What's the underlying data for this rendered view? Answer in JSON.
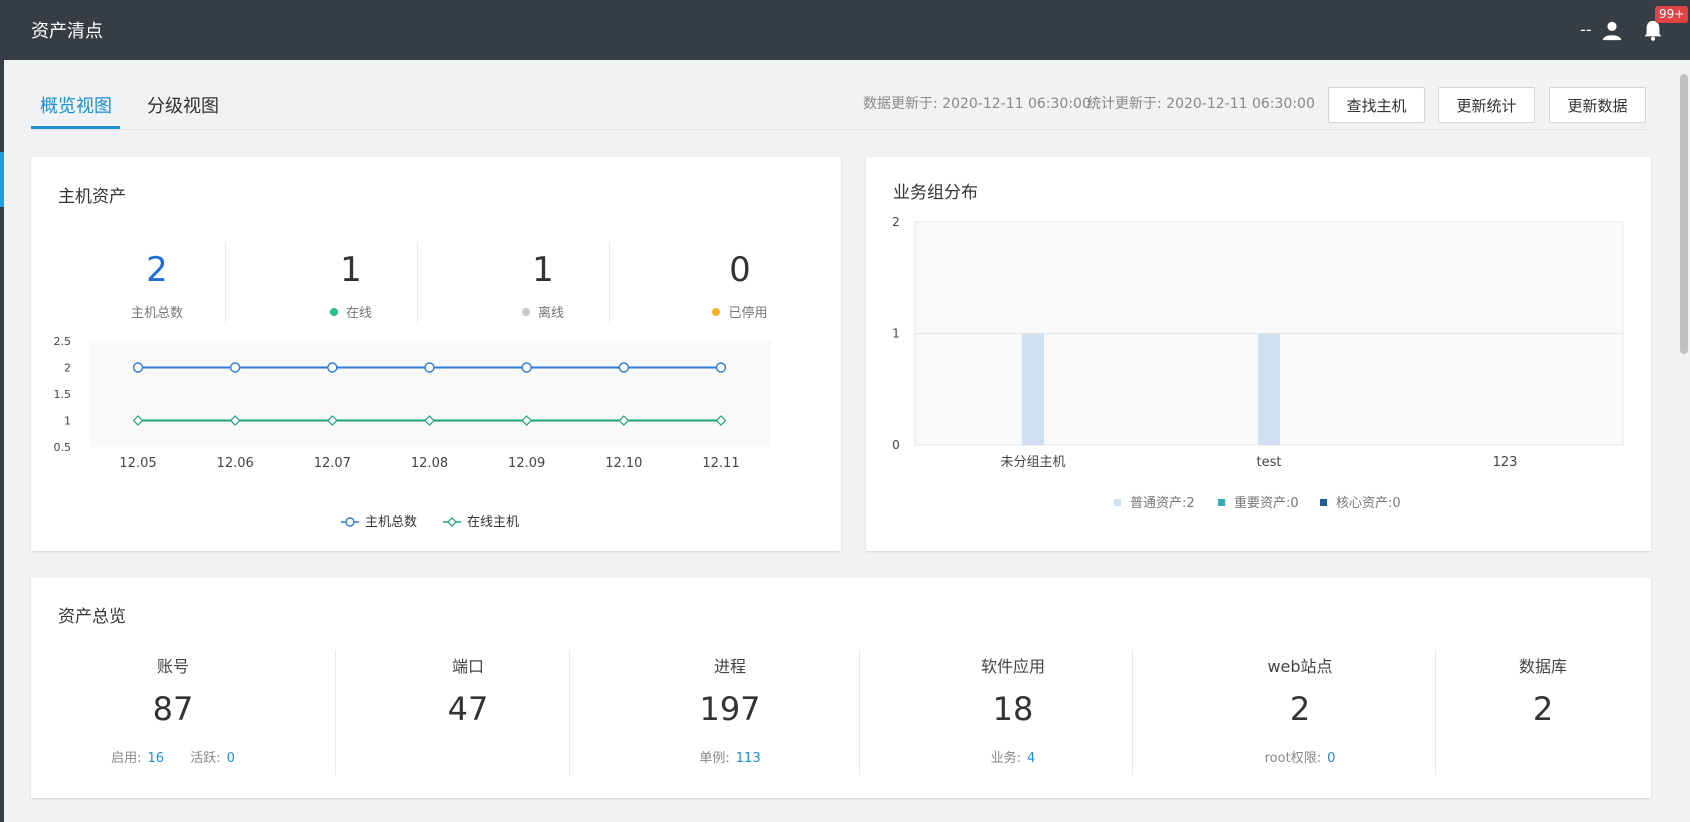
{
  "header": {
    "title": "资产清点",
    "user_name": "--",
    "notification_badge": "99+"
  },
  "tabs": [
    {
      "label": "概览视图",
      "active": true
    },
    {
      "label": "分级视图",
      "active": false
    }
  ],
  "update_info": {
    "data_updated": "数据更新于: 2020-12-11 06:30:00",
    "stats_updated": "统计更新于: 2020-12-11 06:30:00"
  },
  "actions": {
    "find_host": "查找主机",
    "update_stats": "更新统计",
    "update_data": "更新数据"
  },
  "host_assets": {
    "title": "主机资产",
    "stats": [
      {
        "value": "2",
        "label": "主机总数"
      },
      {
        "value": "1",
        "label": "在线",
        "dot_color": "#2bbf8a"
      },
      {
        "value": "1",
        "label": "离线",
        "dot_color": "#c8c8c8"
      },
      {
        "value": "0",
        "label": "已停用",
        "dot_color": "#f0b429"
      }
    ]
  },
  "group_dist": {
    "title": "业务组分布"
  },
  "chart_data": [
    {
      "type": "line",
      "x": [
        "12.05",
        "12.06",
        "12.07",
        "12.08",
        "12.09",
        "12.10",
        "12.11"
      ],
      "yticks": [
        "0.5",
        "1",
        "1.5",
        "2",
        "2.5"
      ],
      "ylim": [
        0.5,
        2.5
      ],
      "series": [
        {
          "name": "主机总数",
          "values": [
            2,
            2,
            2,
            2,
            2,
            2,
            2
          ],
          "color": "#2f7bd6",
          "marker": "circle"
        },
        {
          "name": "在线主机",
          "values": [
            1,
            1,
            1,
            1,
            1,
            1,
            1
          ],
          "color": "#1aa37a",
          "marker": "diamond"
        }
      ],
      "legend": "bottom-center",
      "grid": false
    },
    {
      "type": "bar",
      "categories": [
        "未分组主机",
        "test",
        "123"
      ],
      "yticks": [
        "0",
        "1",
        "2"
      ],
      "ylim": [
        0,
        2
      ],
      "series": [
        {
          "name": "普通资产:2",
          "values": [
            1,
            1,
            0
          ],
          "color": "#cfe0f1"
        },
        {
          "name": "重要资产:0",
          "values": [
            0,
            0,
            0
          ],
          "color": "#3aa9b6"
        },
        {
          "name": "核心资产:0",
          "values": [
            0,
            0,
            0
          ],
          "color": "#1f5d99"
        }
      ],
      "legend": "bottom-center",
      "grid": true
    }
  ],
  "overview": {
    "title": "资产总览",
    "items": [
      {
        "label": "账号",
        "value": "87",
        "sub": [
          {
            "k": "启用:",
            "v": "16"
          },
          {
            "k": "活跃:",
            "v": "0"
          }
        ]
      },
      {
        "label": "端口",
        "value": "47",
        "sub": []
      },
      {
        "label": "进程",
        "value": "197",
        "sub": [
          {
            "k": "单例:",
            "v": "113"
          }
        ]
      },
      {
        "label": "软件应用",
        "value": "18",
        "sub": [
          {
            "k": "业务:",
            "v": "4"
          }
        ]
      },
      {
        "label": "web站点",
        "value": "2",
        "sub": [
          {
            "k": "root权限:",
            "v": "0"
          }
        ]
      },
      {
        "label": "数据库",
        "value": "2",
        "sub": []
      }
    ]
  },
  "colors": {
    "header_bg": "#373d45",
    "accent": "#1c8fd6",
    "link_value": "#1c8fd6"
  }
}
